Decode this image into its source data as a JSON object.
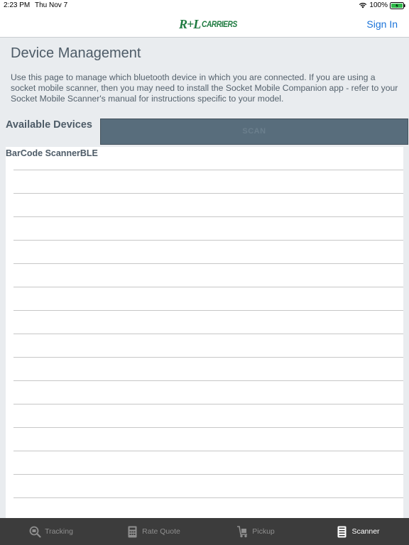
{
  "status": {
    "time": "2:23 PM",
    "date": "Thu Nov 7",
    "battery": "100%"
  },
  "nav": {
    "logo_mark": "R+L",
    "logo_text": "CARRIERS",
    "sign_in": "Sign In"
  },
  "page": {
    "title": "Device Management",
    "description": "Use this page to manage which bluetooth device in which you are connected. If you are using a socket mobile scanner, then you may need to install the Socket Mobile Companion app - refer to your Socket Mobile Scanner's manual for instructions specific to your model."
  },
  "devices": {
    "label": "Available Devices",
    "scan_label": "SCAN",
    "items": [
      "BarCode ScannerBLE",
      "",
      "",
      "",
      "",
      "",
      "",
      "",
      "",
      "",
      "",
      "",
      "",
      "",
      "",
      ""
    ]
  },
  "tabs": [
    {
      "label": "Tracking",
      "icon": "tracking-icon",
      "active": false
    },
    {
      "label": "Rate Quote",
      "icon": "rate-quote-icon",
      "active": false
    },
    {
      "label": "Pickup",
      "icon": "pickup-icon",
      "active": false
    },
    {
      "label": "Scanner",
      "icon": "scanner-icon",
      "active": true
    }
  ],
  "colors": {
    "accent": "#1a73d9",
    "brand_green": "#1d7a3f",
    "scan_button": "#586d7c",
    "tab_bar": "#3c3c3c"
  }
}
